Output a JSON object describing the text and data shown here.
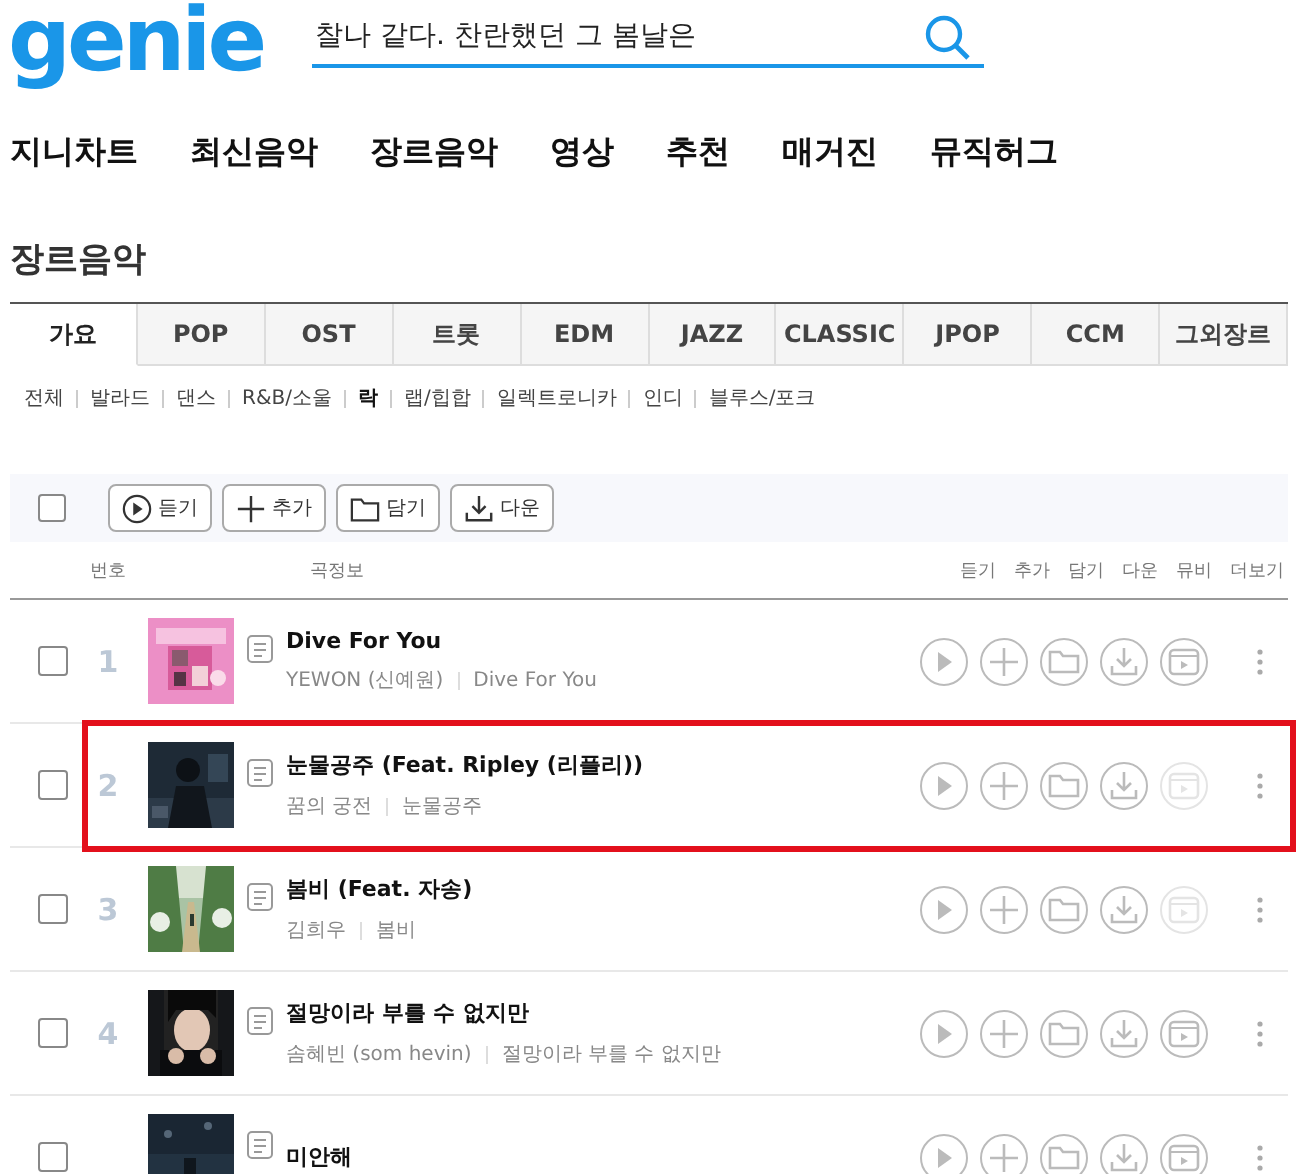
{
  "header": {
    "logo": "genie",
    "search": {
      "value": "찰나 같다. 찬란했던 그 봄날은"
    }
  },
  "nav": [
    "지니차트",
    "최신음악",
    "장르음악",
    "영상",
    "추천",
    "매거진",
    "뮤직허그"
  ],
  "section_title": "장르음악",
  "genre_tabs": [
    {
      "label": "가요",
      "selected": true
    },
    {
      "label": "POP",
      "selected": false
    },
    {
      "label": "OST",
      "selected": false
    },
    {
      "label": "트롯",
      "selected": false
    },
    {
      "label": "EDM",
      "selected": false
    },
    {
      "label": "JAZZ",
      "selected": false
    },
    {
      "label": "CLASSIC",
      "selected": false
    },
    {
      "label": "JPOP",
      "selected": false
    },
    {
      "label": "CCM",
      "selected": false
    },
    {
      "label": "그외장르",
      "selected": false
    }
  ],
  "subgenres": [
    {
      "label": "전체",
      "selected": false
    },
    {
      "label": "발라드",
      "selected": false
    },
    {
      "label": "댄스",
      "selected": false
    },
    {
      "label": "R&B/소울",
      "selected": false
    },
    {
      "label": "락",
      "selected": true
    },
    {
      "label": "랩/힙합",
      "selected": false
    },
    {
      "label": "일렉트로니카",
      "selected": false
    },
    {
      "label": "인디",
      "selected": false
    },
    {
      "label": "블루스/포크",
      "selected": false
    }
  ],
  "toolbar": {
    "select_all": {
      "checked": false
    },
    "buttons": [
      {
        "kind": "play",
        "label": "듣기"
      },
      {
        "kind": "add",
        "label": "추가"
      },
      {
        "kind": "folder",
        "label": "담기"
      },
      {
        "kind": "download",
        "label": "다운"
      }
    ]
  },
  "columns": {
    "number": "번호",
    "info": "곡정보",
    "actions": [
      "듣기",
      "추가",
      "담기",
      "다운",
      "뮤비",
      "더보기"
    ]
  },
  "songs": [
    {
      "number": "1",
      "title": "Dive For You",
      "artist": "YEWON (신예원)",
      "album": "Dive For You",
      "checked": false,
      "video_available": true,
      "highlighted": false
    },
    {
      "number": "2",
      "title": "눈물공주 (Feat. Ripley (리플리))",
      "artist": "꿈의 궁전",
      "album": "눈물공주",
      "checked": false,
      "video_available": false,
      "highlighted": true
    },
    {
      "number": "3",
      "title": "봄비 (Feat. 자송)",
      "artist": "김희우",
      "album": "봄비",
      "checked": false,
      "video_available": false,
      "highlighted": false
    },
    {
      "number": "4",
      "title": "절망이라 부를 수 없지만",
      "artist": "솜혜빈 (som hevin)",
      "album": "절망이라 부를 수 없지만",
      "checked": false,
      "video_available": true,
      "highlighted": false
    },
    {
      "title": "미안해",
      "checked": false,
      "video_available": true,
      "highlighted": false
    }
  ]
}
